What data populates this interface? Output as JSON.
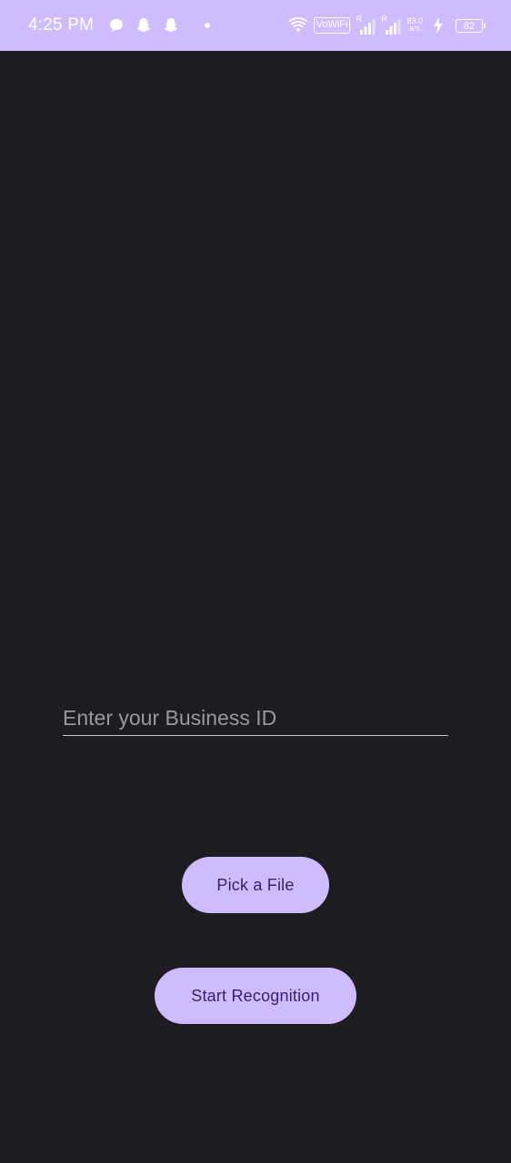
{
  "status_bar": {
    "time": "4:25 PM",
    "left_icons": [
      "chat-bubble-icon",
      "snapchat-icon",
      "snapchat-icon",
      "dot-icon"
    ],
    "wifi_label": "VoWiFi",
    "signal_1_label": "R",
    "signal_2_label": "R",
    "net_speed_value": "83.0",
    "net_speed_unit": "B/S",
    "battery_level": "82",
    "background_color": "#cfbcff"
  },
  "form": {
    "business_id": {
      "placeholder": "Enter your Business ID",
      "value": ""
    },
    "pick_file_label": "Pick a File",
    "start_recognition_label": "Start Recognition"
  },
  "colors": {
    "background": "#1d1c21",
    "accent": "#cfbcff",
    "button_text": "#381e72"
  }
}
